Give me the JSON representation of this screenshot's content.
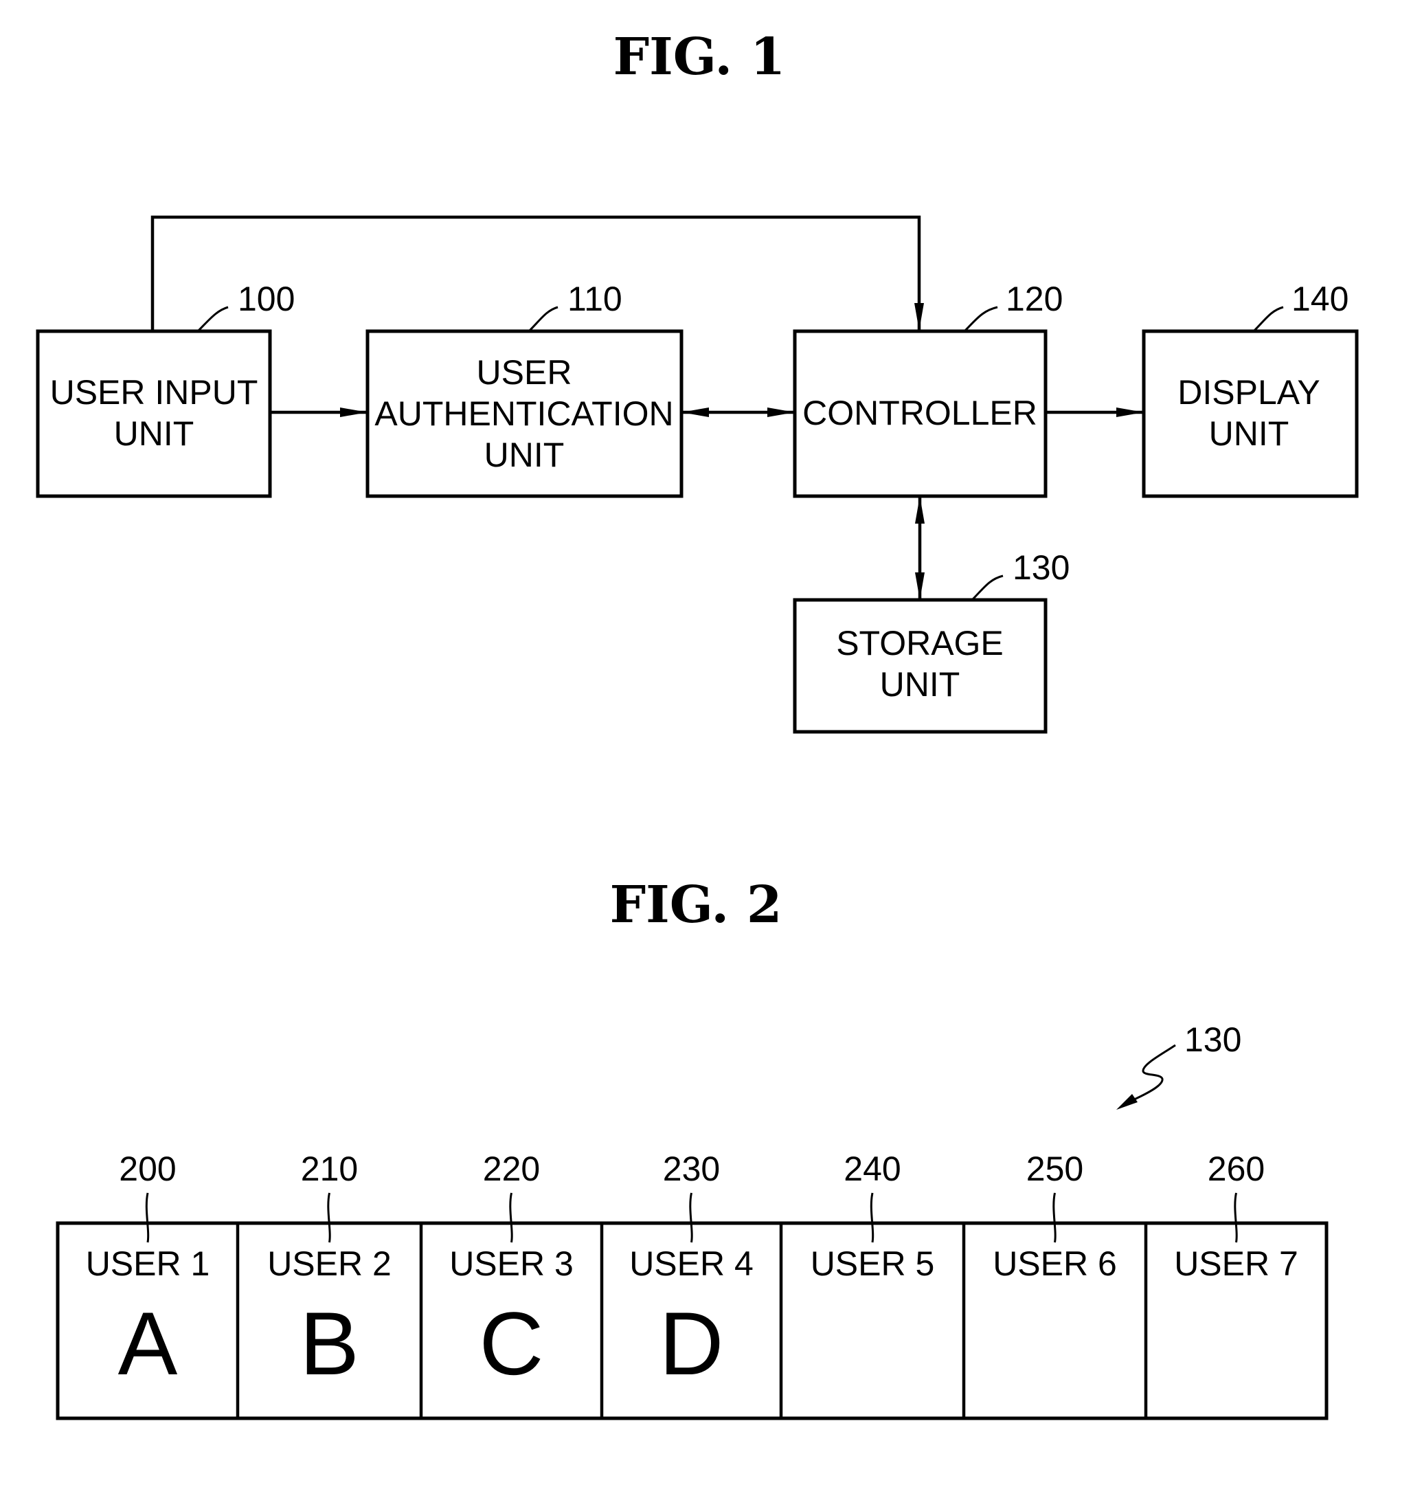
{
  "fig1": {
    "title": "FIG. 1",
    "blocks": [
      {
        "id": "user-input-unit",
        "ref": "100",
        "lines": [
          "USER INPUT",
          "UNIT"
        ]
      },
      {
        "id": "user-authentication-unit",
        "ref": "110",
        "lines": [
          "USER",
          "AUTHENTICATION",
          "UNIT"
        ]
      },
      {
        "id": "controller",
        "ref": "120",
        "lines": [
          "CONTROLLER"
        ]
      },
      {
        "id": "storage-unit",
        "ref": "130",
        "lines": [
          "STORAGE",
          "UNIT"
        ]
      },
      {
        "id": "display-unit",
        "ref": "140",
        "lines": [
          "DISPLAY",
          "UNIT"
        ]
      }
    ],
    "connections": [
      {
        "from": "user-input-unit",
        "to": "controller",
        "direction": "one-way",
        "route": "over-top"
      },
      {
        "from": "user-input-unit",
        "to": "user-authentication-unit",
        "direction": "one-way"
      },
      {
        "from": "user-authentication-unit",
        "to": "controller",
        "direction": "two-way"
      },
      {
        "from": "controller",
        "to": "display-unit",
        "direction": "one-way"
      },
      {
        "from": "controller",
        "to": "storage-unit",
        "direction": "two-way"
      }
    ]
  },
  "fig2": {
    "title": "FIG. 2",
    "storage_ref": "130",
    "cells": [
      {
        "ref": "200",
        "user": "USER 1",
        "value": "A"
      },
      {
        "ref": "210",
        "user": "USER 2",
        "value": "B"
      },
      {
        "ref": "220",
        "user": "USER 3",
        "value": "C"
      },
      {
        "ref": "230",
        "user": "USER 4",
        "value": "D"
      },
      {
        "ref": "240",
        "user": "USER 5",
        "value": ""
      },
      {
        "ref": "250",
        "user": "USER 6",
        "value": ""
      },
      {
        "ref": "260",
        "user": "USER 7",
        "value": ""
      }
    ]
  }
}
